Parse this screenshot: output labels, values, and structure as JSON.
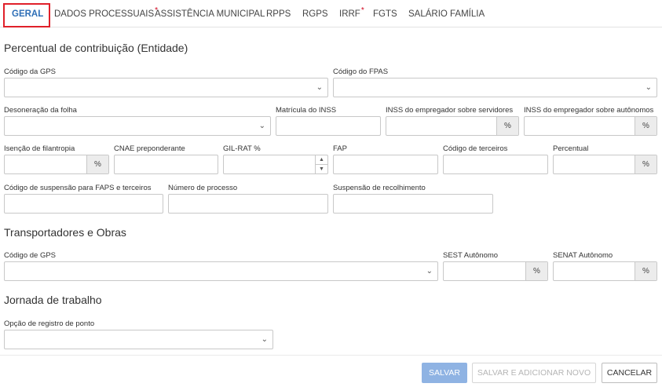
{
  "tabs": [
    {
      "label": "GERAL",
      "required": false
    },
    {
      "label": "DADOS PROCESSUAIS",
      "required": true
    },
    {
      "label": "ASSISTÊNCIA MUNICIPAL",
      "required": false
    },
    {
      "label": "RPPS",
      "required": false
    },
    {
      "label": "RGPS",
      "required": false
    },
    {
      "label": "IRRF",
      "required": true
    },
    {
      "label": "FGTS",
      "required": false
    },
    {
      "label": "SALÁRIO FAMÍLIA",
      "required": false
    }
  ],
  "required_mark": "*",
  "sections": {
    "contribuicao": "Percentual de contribuição (Entidade)",
    "transportadores": "Transportadores e Obras",
    "jornada": "Jornada de trabalho"
  },
  "fields": {
    "codigo_gps": "Código da GPS",
    "codigo_fpas": "Código do FPAS",
    "desoneracao": "Desoneração da folha",
    "matricula_inss": "Matrícula do INSS",
    "inss_servidores": "INSS do empregador sobre servidores",
    "inss_autonomos": "INSS do empregador sobre autônomos",
    "isencao": "Isenção de filantropia",
    "cnae": "CNAE preponderante",
    "gil_rat": "GIL-RAT %",
    "fap": "FAP",
    "codigo_terceiros": "Código de terceiros",
    "percentual": "Percentual",
    "codigo_suspensao": "Código de suspensão para FAPS e terceiros",
    "numero_processo": "Número de processo",
    "suspensao_recolhimento": "Suspensão de recolhimento",
    "codigo_gps_obras": "Código de GPS",
    "sest": "SEST Autônomo",
    "senat": "SENAT Autônomo",
    "opcao_ponto": "Opção de registro de ponto"
  },
  "suffix_percent": "%",
  "icons": {
    "dropdown": "chevron-down-icon",
    "spin_up": "▲",
    "spin_down": "▼",
    "chevron": "⌄"
  },
  "buttons": {
    "save": "SALVAR",
    "save_new": "SALVAR E ADICIONAR NOVO",
    "cancel": "CANCELAR"
  },
  "colors": {
    "active_tab": "#2f6fb7",
    "required": "#d0021b",
    "active_tab_border": "#e0202a",
    "save_button": "#8fb3e3"
  }
}
